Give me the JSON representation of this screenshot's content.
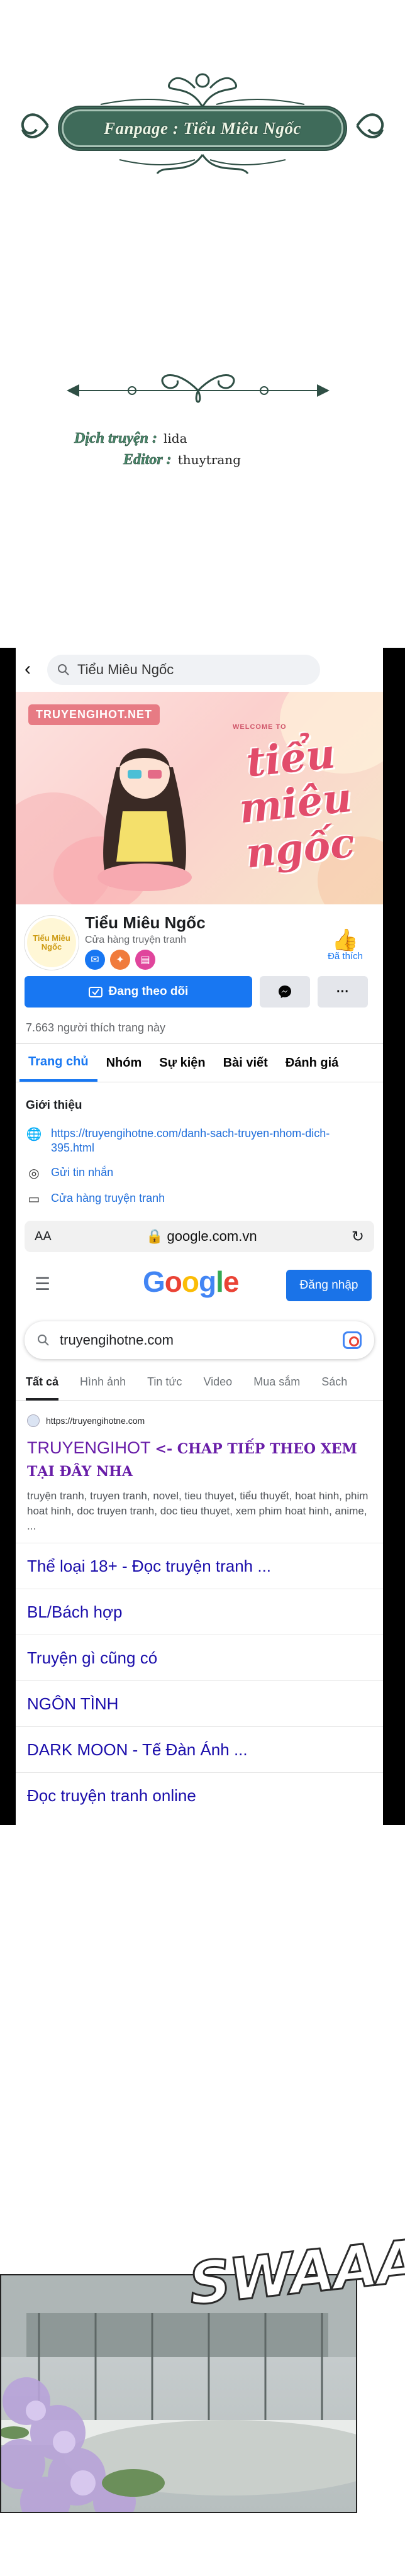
{
  "credits": {
    "fanpage": "Fanpage : Tiểu Miêu Ngốc",
    "translator_label": "Dịch truyện :",
    "translator_name": "lida",
    "editor_label": "Editor :",
    "editor_name": "thuytrang"
  },
  "facebook": {
    "search_query": "Tiểu Miêu Ngốc",
    "cover": {
      "site_tag": "TRUYENGIHOT.NET",
      "welcome": "WELCOME TO",
      "title": "tiểu miêu ngốc"
    },
    "avatar_text": "Tiểu Miêu Ngốc",
    "page_name": "Tiểu Miêu Ngốc",
    "category": "Cửa hàng truyện tranh",
    "like_label": "Đã thích",
    "follow_label": "Đang theo dõi",
    "more_label": "···",
    "likes_count": "7.663 người thích trang này",
    "tabs": [
      "Trang chủ",
      "Nhóm",
      "Sự kiện",
      "Bài viết",
      "Đánh giá"
    ],
    "intro_title": "Giới thiệu",
    "intro_items": [
      {
        "icon": "globe-icon",
        "text": "https://truyengihotne.com/danh-sach-truyen-nhom-dich-395.html"
      },
      {
        "icon": "messenger-icon",
        "text": "Gửi tin nhắn"
      },
      {
        "icon": "shop-icon",
        "text": "Cửa hàng truyện tranh"
      }
    ]
  },
  "browser": {
    "aa_label": "AA",
    "url": "google.com.vn"
  },
  "google": {
    "logo_letters": [
      "G",
      "o",
      "o",
      "g",
      "l",
      "e"
    ],
    "signin_label": "Đăng nhập",
    "query": "truyengihotne.com",
    "tabs": [
      "Tất cả",
      "Hình ảnh",
      "Tin tức",
      "Video",
      "Mua sắm",
      "Sách"
    ],
    "result": {
      "source": "https://truyengihotne.com",
      "title": "TRUYENGIHOT",
      "title_tag": "<- CHAP TIẾP THEO XEM TẠI ĐÂY NHA",
      "description": "truyện tranh, truyen tranh, novel, tieu thuyet, tiểu thuyết, hoat hinh, phim hoat hinh, doc truyen tranh, doc tieu thuyet, xem phim hoat hinh, anime, ..."
    },
    "sitelinks": [
      "Thể loại 18+ - Đọc truyện tranh ...",
      "BL/Bách hợp",
      "Truyện gì cũng có",
      "NGÔN TÌNH",
      "DARK MOON - Tế Đàn Ánh ...",
      "Đọc truyện tranh online"
    ]
  },
  "comic": {
    "sfx": "SWAAA"
  },
  "colors": {
    "facebook_blue": "#1877f2",
    "link_blue": "#1a0dab",
    "visited_purple": "#681da8",
    "plate_green": "#3f6b5a"
  }
}
